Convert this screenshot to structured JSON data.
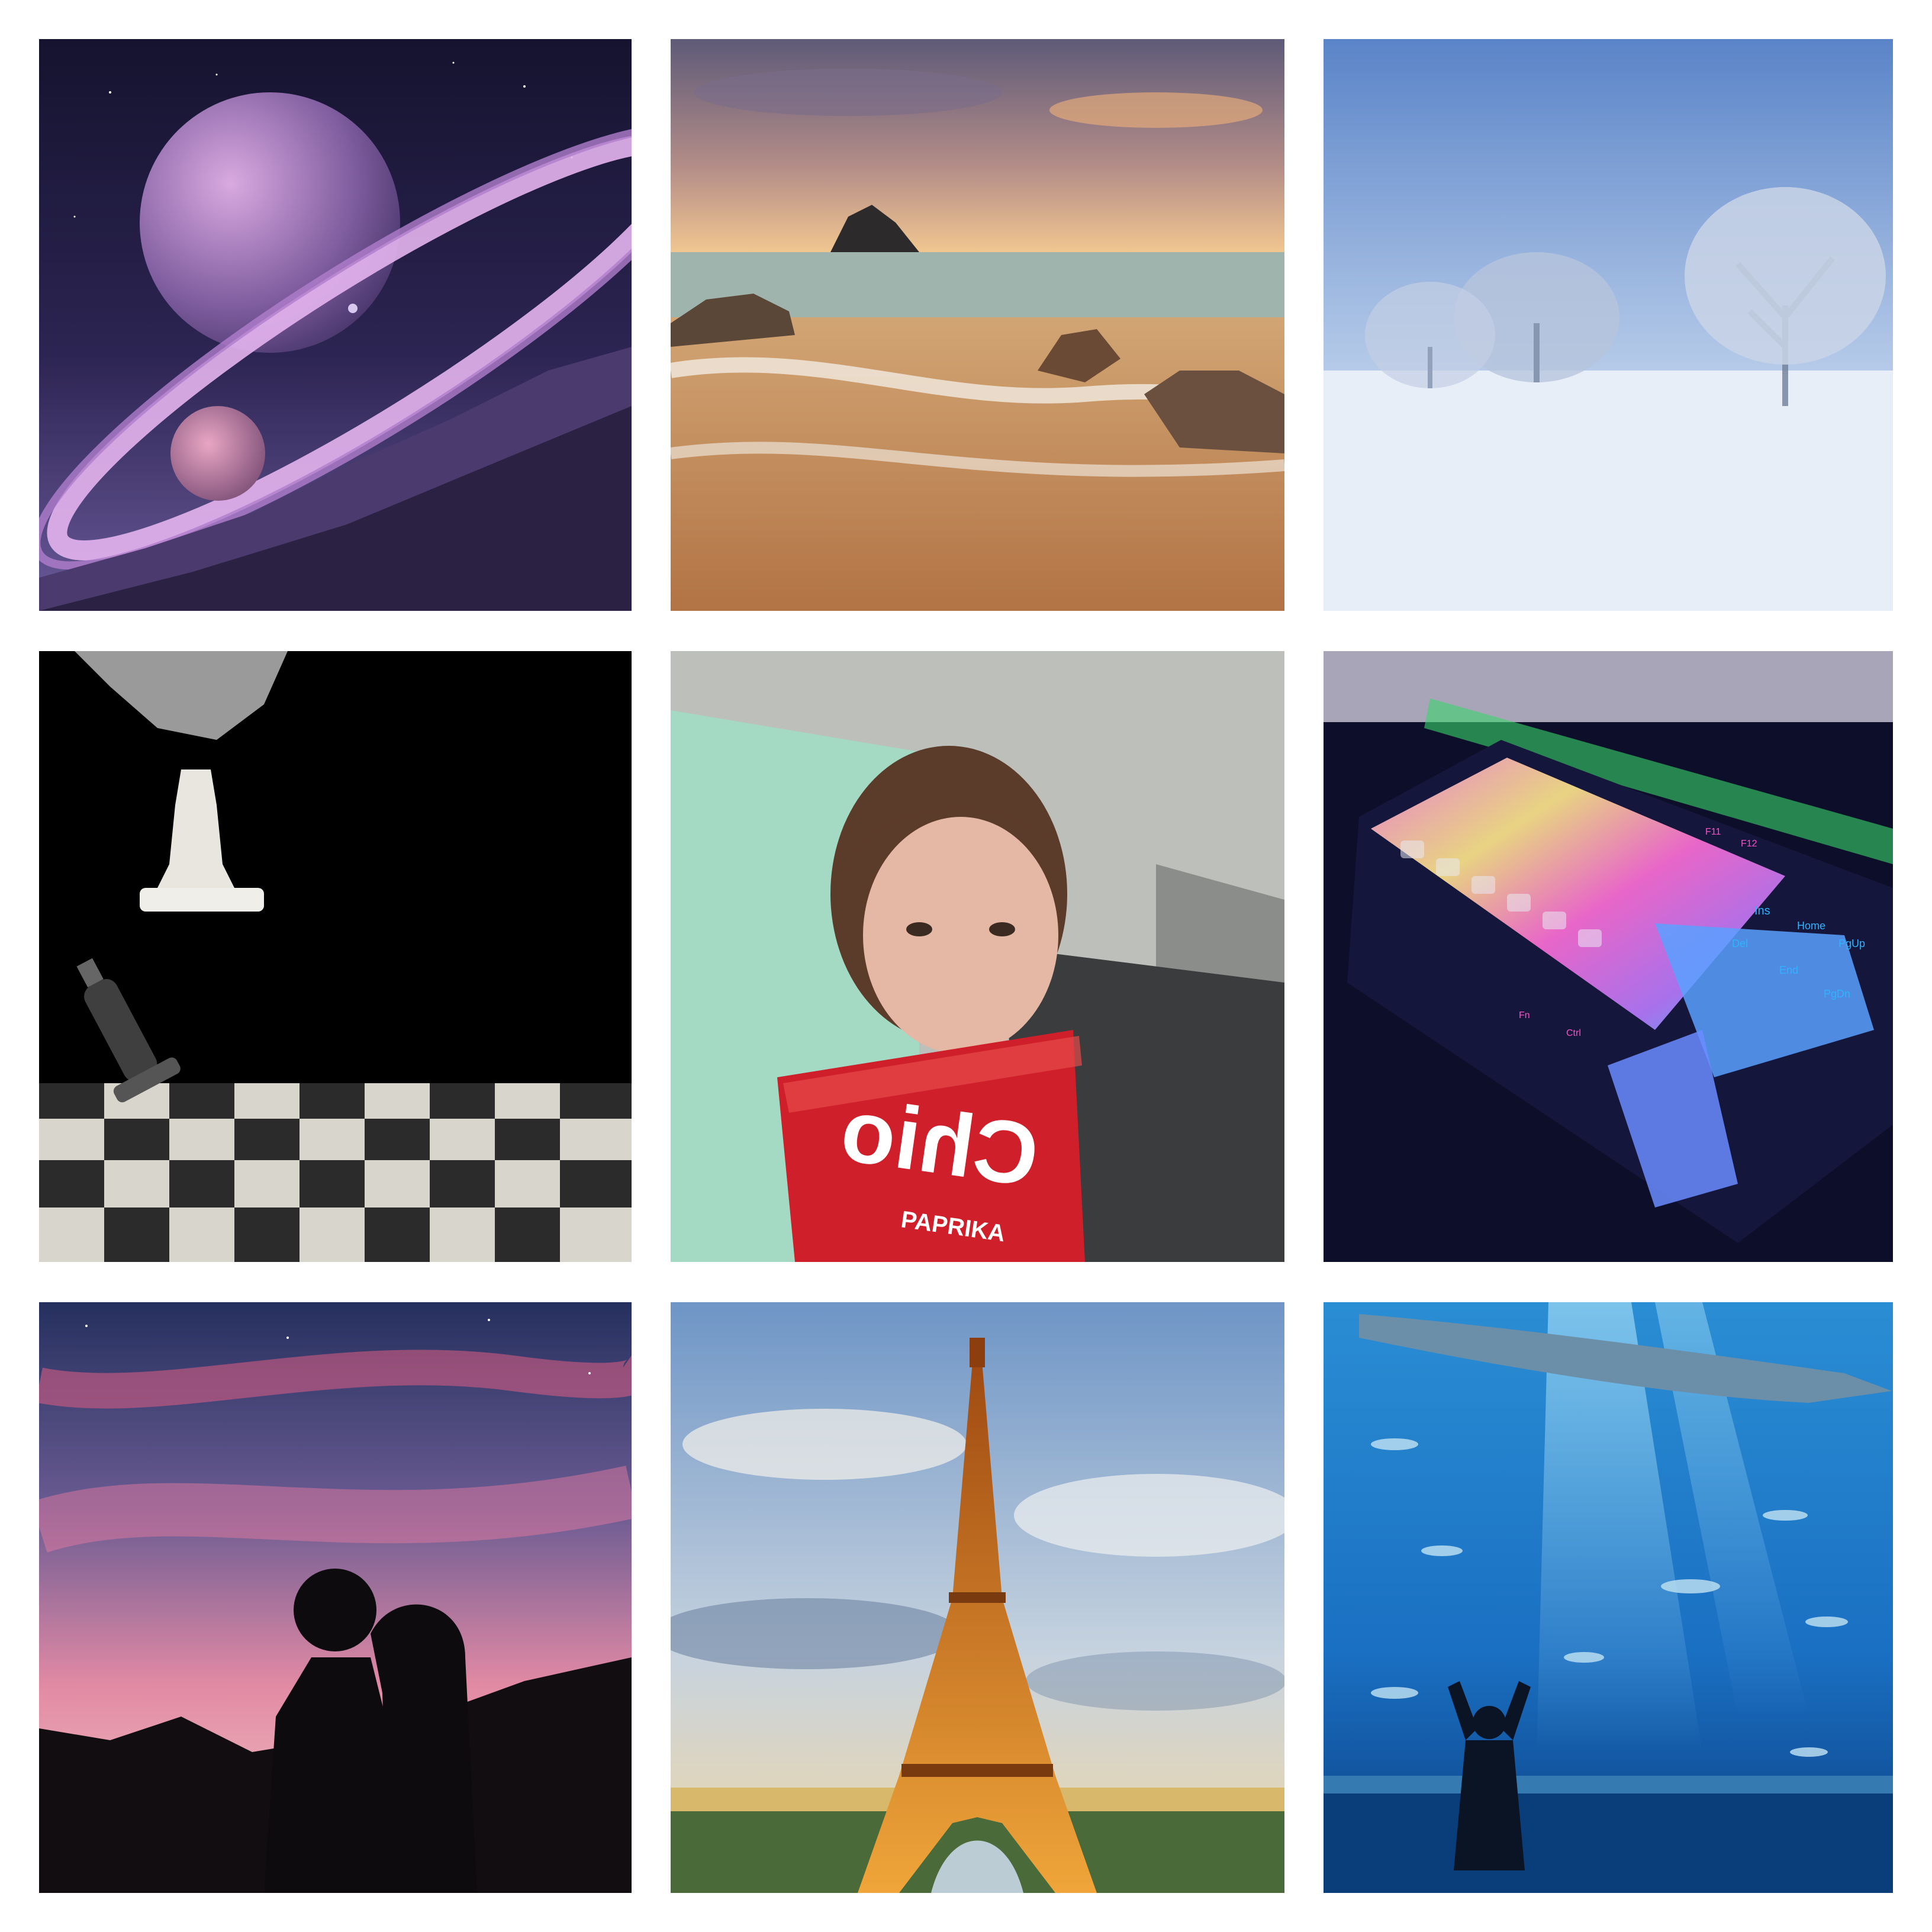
{
  "collage": {
    "background": "#ffffff",
    "tiles": [
      {
        "subject": "planet-rings-scene",
        "palette": [
          "#1c1a3d",
          "#c79ad8",
          "#8b6fb3"
        ]
      },
      {
        "subject": "beach-sunset-scene",
        "palette": [
          "#8d7a8d",
          "#d7a46e",
          "#c9875a"
        ]
      },
      {
        "subject": "winter-trees-scene",
        "palette": [
          "#5f86c9",
          "#c9d6ee",
          "#e8eef8"
        ]
      },
      {
        "subject": "chess-scene",
        "palette": [
          "#000000",
          "#e8e6df",
          "#3a3a3a"
        ]
      },
      {
        "subject": "selfie-scene",
        "palette": [
          "#a9d8c6",
          "#6b4a35",
          "#d21f2a"
        ]
      },
      {
        "subject": "rgb-keyboard-scene",
        "palette": [
          "#0d0f2e",
          "#ff7bd9",
          "#4fc3ff"
        ]
      },
      {
        "subject": "couple-silhouette-scene",
        "palette": [
          "#2b3566",
          "#e38aa2",
          "#111111"
        ]
      },
      {
        "subject": "eiffel-tower-scene",
        "palette": [
          "#6f95c3",
          "#e6a13a",
          "#f3e2b5"
        ]
      },
      {
        "subject": "aquarium-scene",
        "palette": [
          "#0f5aa8",
          "#6cc9f0",
          "#0a2a55"
        ]
      }
    ],
    "snack_bag": {
      "brand": "Chio",
      "flavor": "PAPRIKA"
    },
    "keyboard_legends": [
      "Ins",
      "Home",
      "PgUp",
      "Del",
      "End",
      "PgDn",
      "Fn",
      "Ctrl",
      "F11",
      "F12"
    ]
  }
}
